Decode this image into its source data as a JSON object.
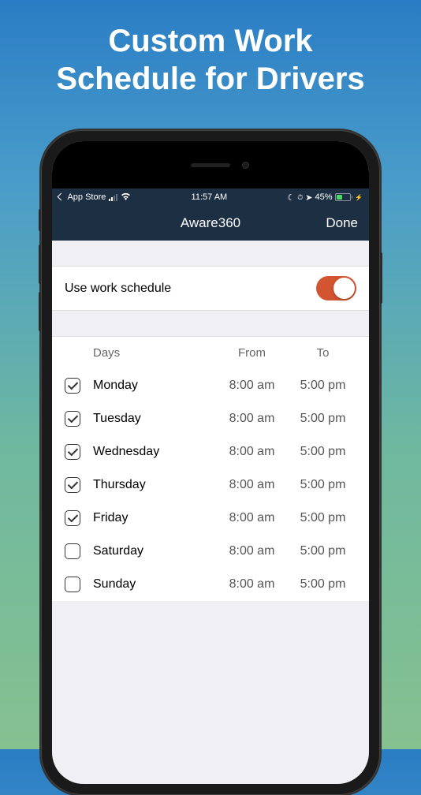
{
  "promo": {
    "line1": "Custom Work",
    "line2": "Schedule for Drivers"
  },
  "statusBar": {
    "backLabel": "App Store",
    "time": "11:57 AM",
    "batteryText": "45%"
  },
  "navBar": {
    "title": "Aware360",
    "done": "Done"
  },
  "toggle": {
    "label": "Use work schedule"
  },
  "scheduleHeaders": {
    "days": "Days",
    "from": "From",
    "to": "To"
  },
  "schedule": [
    {
      "day": "Monday",
      "from": "8:00 am",
      "to": "5:00 pm",
      "checked": true
    },
    {
      "day": "Tuesday",
      "from": "8:00 am",
      "to": "5:00 pm",
      "checked": true
    },
    {
      "day": "Wednesday",
      "from": "8:00 am",
      "to": "5:00 pm",
      "checked": true
    },
    {
      "day": "Thursday",
      "from": "8:00 am",
      "to": "5:00 pm",
      "checked": true
    },
    {
      "day": "Friday",
      "from": "8:00 am",
      "to": "5:00 pm",
      "checked": true
    },
    {
      "day": "Saturday",
      "from": "8:00 am",
      "to": "5:00 pm",
      "checked": false
    },
    {
      "day": "Sunday",
      "from": "8:00 am",
      "to": "5:00 pm",
      "checked": false
    }
  ]
}
